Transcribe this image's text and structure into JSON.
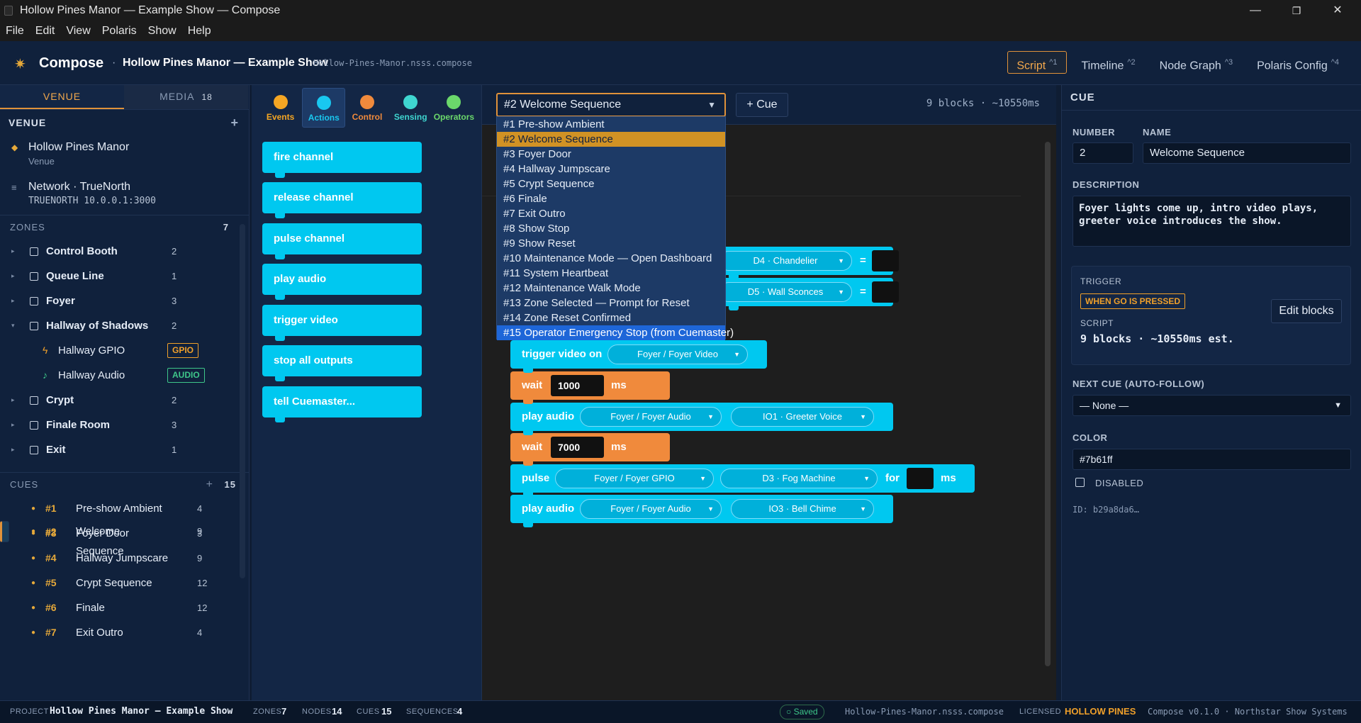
{
  "window": {
    "title": "Hollow Pines Manor — Example Show — Compose",
    "minimize": "—",
    "maximize": "❐",
    "close": "✕"
  },
  "menu": [
    "File",
    "Edit",
    "View",
    "Polaris",
    "Show",
    "Help"
  ],
  "header": {
    "logo_icon": "sun-icon",
    "app": "Compose",
    "separator": "·",
    "show": "Hollow Pines Manor — Example Show",
    "file": "Hollow-Pines-Manor.nsss.compose",
    "tabs": [
      {
        "label": "Script",
        "key": "^1",
        "active": true
      },
      {
        "label": "Timeline",
        "key": "^2"
      },
      {
        "label": "Node Graph",
        "key": "^3"
      },
      {
        "label": "Polaris Config",
        "key": "^4"
      }
    ]
  },
  "left": {
    "tabs": {
      "venue": "VENUE",
      "media": "MEDIA",
      "media_count": "18"
    },
    "venue_header": "VENUE",
    "venue_add": "+",
    "venue": {
      "name": "Hollow Pines Manor",
      "type": "Venue"
    },
    "network": {
      "name": "Network · TrueNorth",
      "addr": "TRUENORTH 10.0.0.1:3000"
    },
    "zones_header": "ZONES",
    "zones_count": "7",
    "zones": [
      {
        "name": "Control Booth",
        "count": "2"
      },
      {
        "name": "Queue Line",
        "count": "1"
      },
      {
        "name": "Foyer",
        "count": "3"
      },
      {
        "name": "Hallway of Shadows",
        "count": "2",
        "expanded": true
      },
      {
        "name": "Crypt",
        "count": "2"
      },
      {
        "name": "Finale Room",
        "count": "3"
      },
      {
        "name": "Exit",
        "count": "1"
      }
    ],
    "hallway_nodes": [
      {
        "name": "Hallway GPIO",
        "tag": "GPIO",
        "icon": "bolt-icon",
        "color": "#f0a02a"
      },
      {
        "name": "Hallway Audio",
        "tag": "AUDIO",
        "icon": "music-note-icon",
        "color": "#3ec78a"
      }
    ],
    "cues_header": "CUES",
    "cues_add": "+",
    "cues_count": "15",
    "cues": [
      {
        "num": "#1",
        "name": "Pre-show Ambient",
        "count": "4"
      },
      {
        "num": "#2",
        "name": "Welcome Sequence",
        "count": "9",
        "selected": true
      },
      {
        "num": "#3",
        "name": "Foyer Door",
        "count": "3"
      },
      {
        "num": "#4",
        "name": "Hallway Jumpscare",
        "count": "9"
      },
      {
        "num": "#5",
        "name": "Crypt Sequence",
        "count": "12"
      },
      {
        "num": "#6",
        "name": "Finale",
        "count": "12"
      },
      {
        "num": "#7",
        "name": "Exit Outro",
        "count": "4"
      }
    ]
  },
  "palette": {
    "categories": [
      {
        "label": "Events",
        "color": "#f5a623"
      },
      {
        "label": "Actions",
        "color": "#19c8f0",
        "active": true
      },
      {
        "label": "Control",
        "color": "#f08a3c"
      },
      {
        "label": "Sensing",
        "color": "#3fd6d0"
      },
      {
        "label": "Operators",
        "color": "#6bd86b"
      }
    ],
    "blocks": [
      "fire channel",
      "release channel",
      "pulse channel",
      "play audio",
      "trigger video",
      "stop all outputs",
      "tell Cuemaster..."
    ]
  },
  "workspace": {
    "cue_select": "#2 Welcome Sequence",
    "add_cue": "+ Cue",
    "info": "9 blocks · ~10550ms",
    "dropdown": [
      "#1 Pre-show Ambient",
      "#2 Welcome Sequence",
      "#3 Foyer Door",
      "#4 Hallway Jumpscare",
      "#5 Crypt Sequence",
      "#6 Finale",
      "#7 Exit Outro",
      "#8 Show Stop",
      "#9 Show Reset",
      "#10 Maintenance Mode — Open Dashboard",
      "#11 System Heartbeat",
      "#12 Maintenance Walk Mode",
      "#13 Zone Selected — Prompt for Reset",
      "#14 Zone Reset Confirmed",
      "#15 Operator Emergency Stop (from Cuemaster)"
    ],
    "dropdown_current": 1,
    "dropdown_hover": 14,
    "blocks": {
      "chandelier": "D4 · Chandelier",
      "sconces": "D5 · Wall Sconces",
      "eq": "=",
      "trigger_video": "trigger video on",
      "foyer_video": "Foyer / Foyer Video",
      "wait": "wait",
      "ms": "ms",
      "wait1": "1000",
      "play_audio": "play audio",
      "foyer_audio": "Foyer / Foyer Audio",
      "greeter": "IO1 · Greeter Voice",
      "wait2": "7000",
      "pulse": "pulse",
      "foyer_gpio": "Foyer / Foyer GPIO",
      "fog": "D3 · Fog Machine",
      "for": "for",
      "bell": "IO3 · Bell Chime"
    }
  },
  "right": {
    "header": "CUE",
    "number_label": "NUMBER",
    "number": "2",
    "name_label": "NAME",
    "name": "Welcome Sequence",
    "desc_label": "DESCRIPTION",
    "desc": "Foyer lights come up, intro video plays, greeter voice introduces the show.",
    "trigger_label": "TRIGGER",
    "trigger": "WHEN GO IS PRESSED",
    "script_label": "SCRIPT",
    "script": "9 blocks · ~10550ms est.",
    "edit": "Edit blocks",
    "next_label": "NEXT CUE (AUTO-FOLLOW)",
    "next": "— None —",
    "color_label": "COLOR",
    "color": "#7b61ff",
    "disabled_label": "DISABLED",
    "id": "ID: b29a8da6…"
  },
  "status": {
    "project_k": "PROJECT",
    "project_v": "Hollow Pines Manor — Example Show",
    "zones_k": "ZONES",
    "zones_v": "7",
    "nodes_k": "NODES",
    "nodes_v": "14",
    "cues_k": "CUES",
    "cues_v": "15",
    "seq_k": "SEQUENCES",
    "seq_v": "4",
    "saved": "○ Saved",
    "file": "Hollow-Pines-Manor.nsss.compose",
    "lic_k": "LICENSED",
    "lic_v": "HOLLOW PINES",
    "version": "Compose v0.1.0 · Northstar Show Systems"
  }
}
